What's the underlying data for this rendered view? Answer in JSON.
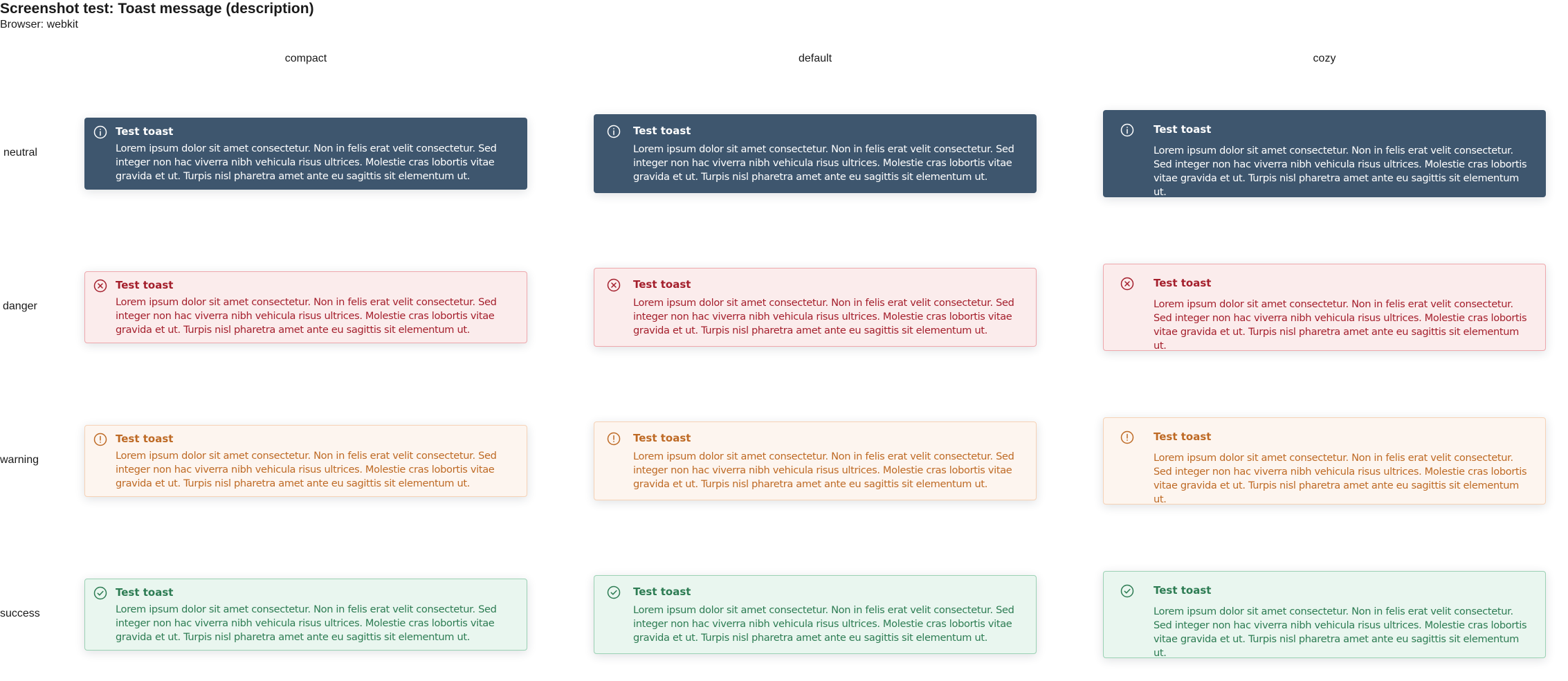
{
  "header": {
    "title": "Screenshot test: Toast message (description)",
    "browser": "Browser: webkit"
  },
  "columns": [
    "compact",
    "default",
    "cozy"
  ],
  "rows": [
    "neutral",
    "danger",
    "warning",
    "success"
  ],
  "toast": {
    "title": "Test toast",
    "description": "Lorem ipsum dolor sit amet consectetur. Non in felis erat velit consectetur. Sed integer non hac viverra nibh vehicula risus ultrices. Molestie cras lobortis vitae gravida et ut. Turpis nisl pharetra amet ante eu sagittis sit elementum ut."
  },
  "icons": {
    "neutral": "info-icon",
    "danger": "close-circle-icon",
    "warning": "exclamation-circle-icon",
    "success": "check-circle-icon"
  },
  "colors": {
    "neutral_bg": "#3e566e",
    "danger_bg": "#fbecec",
    "danger_text": "#a41f2c",
    "warning_bg": "#fdf5ef",
    "warning_text": "#be6a25",
    "success_bg": "#e9f6ef",
    "success_text": "#2d7c53"
  }
}
